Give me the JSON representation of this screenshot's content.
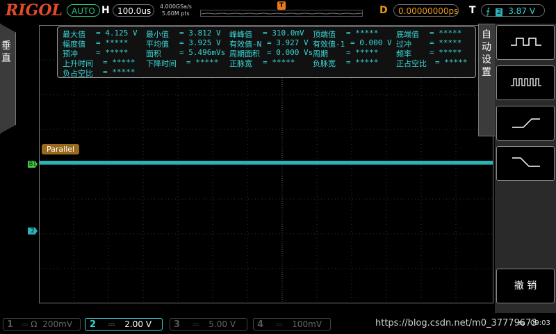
{
  "header": {
    "brand": "RIGOL",
    "trigger_mode": "AUTO",
    "h_label": "H",
    "timebase": "100.0us",
    "sample_rate": "4.000GSa/s",
    "memory_depth": "5.60M pts",
    "trigger_marker": "T",
    "d_label": "D",
    "delay": "0.00000000ps",
    "t_label": "T",
    "trigger_channel": "2",
    "trigger_level": "3.87 V"
  },
  "left_tab": {
    "label": "垂直"
  },
  "right_tab": {
    "label": "自动设置"
  },
  "measurements": {
    "rows": [
      [
        {
          "label": "最大值",
          "value": "= 4.125 V"
        },
        {
          "label": "最小值",
          "value": "= 3.812 V"
        },
        {
          "label": "峰峰值",
          "value": "= 310.0mV"
        },
        {
          "label": "顶端值",
          "value": "= *****"
        },
        {
          "label": "底端值",
          "value": "= *****"
        }
      ],
      [
        {
          "label": "幅度值",
          "value": "= *****"
        },
        {
          "label": "平均值",
          "value": "= 3.925 V"
        },
        {
          "label": "有效值-N",
          "value": "= 3.927 V"
        },
        {
          "label": "有效值-1",
          "value": "= 0.000 V"
        },
        {
          "label": "过冲",
          "value": "= *****"
        }
      ],
      [
        {
          "label": "预冲",
          "value": "= *****"
        },
        {
          "label": "面积",
          "value": "= 5.496mVs"
        },
        {
          "label": "周期面积",
          "value": "= 0.000 Vs"
        },
        {
          "label": "周期",
          "value": "= *****"
        },
        {
          "label": "频率",
          "value": "= *****"
        }
      ],
      [
        {
          "label": "上升时间",
          "value": "= *****"
        },
        {
          "label": "下降时间",
          "value": "= *****"
        },
        {
          "label": "正脉宽",
          "value": "= *****"
        },
        {
          "label": "负脉宽",
          "value": "= *****"
        },
        {
          "label": "正占空比",
          "value": "= *****"
        }
      ],
      [
        {
          "label": "负占空比",
          "value": "= *****"
        }
      ]
    ]
  },
  "decode": {
    "label": "Parallel",
    "bus_marker": "B1"
  },
  "channel2_marker": "2",
  "right_menu": {
    "cancel_label": "撤 销"
  },
  "channels": [
    {
      "num": "1",
      "coupling": "Ω",
      "scale": "200mV"
    },
    {
      "num": "2",
      "coupling": "",
      "scale": "2.00 V"
    },
    {
      "num": "3",
      "coupling": "",
      "scale": "5.00 V"
    },
    {
      "num": "4",
      "coupling": "",
      "scale": "100mV"
    }
  ],
  "watermark": "https://blog.csdn.net/m0_37779673",
  "clock": "09:03",
  "colors": {
    "ch2": "#2ab3b8",
    "brand": "#e34a2a",
    "meas_text": "#3ad7d7",
    "decode_bg": "#9a6a1c",
    "bus_marker": "#45c94a"
  }
}
